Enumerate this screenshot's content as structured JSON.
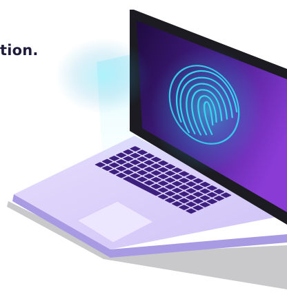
{
  "heading": {
    "visible_text": "tion."
  },
  "illustration": {
    "subject": "laptop-with-fingerprint-scan",
    "icon": "fingerprint-icon",
    "colors": {
      "screen_dark": "#2a1050",
      "screen_purple": "#7a2fc4",
      "scan_glow": "#37d6f0",
      "body_light": "#dcd3fb",
      "body_mid": "#c8bbf5",
      "body_edge": "#a99be3",
      "keys": "#3d1f7e",
      "bezel": "#1c1b22",
      "shadow": "#c9c9cc"
    }
  }
}
